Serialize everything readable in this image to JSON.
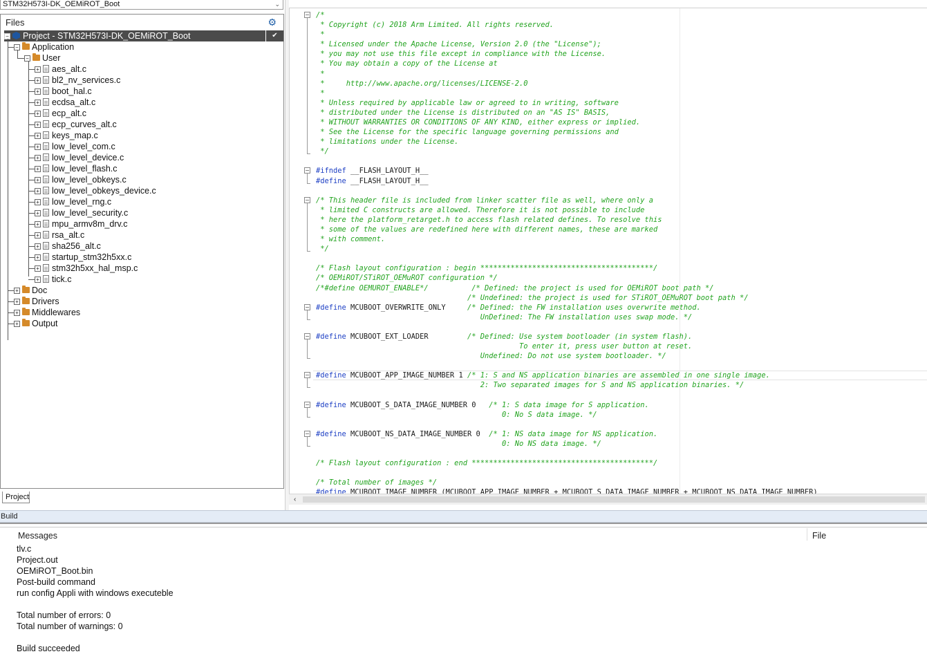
{
  "project_selector": "STM32H573I-DK_OEMiROT_Boot",
  "files_panel": {
    "title": "Files",
    "root": "Project - STM32H573I-DK_OEMiROT_Boot",
    "application": "Application",
    "user": "User",
    "user_files": [
      "aes_alt.c",
      "bl2_nv_services.c",
      "boot_hal.c",
      "ecdsa_alt.c",
      "ecp_alt.c",
      "ecp_curves_alt.c",
      "keys_map.c",
      "low_level_com.c",
      "low_level_device.c",
      "low_level_flash.c",
      "low_level_obkeys.c",
      "low_level_obkeys_device.c",
      "low_level_rng.c",
      "low_level_security.c",
      "mpu_armv8m_drv.c",
      "rsa_alt.c",
      "sha256_alt.c",
      "startup_stm32h5xx.c",
      "stm32h5xx_hal_msp.c",
      "tick.c"
    ],
    "folders": [
      "Doc",
      "Drivers",
      "Middlewares",
      "Output"
    ],
    "tab": "Project"
  },
  "editor": {
    "lines": [
      {
        "text": "/*",
        "kind": "cm"
      },
      {
        "text": " * Copyright (c) 2018 Arm Limited. All rights reserved.",
        "kind": "cm"
      },
      {
        "text": " *",
        "kind": "cm"
      },
      {
        "text": " * Licensed under the Apache License, Version 2.0 (the \"License\");",
        "kind": "cm"
      },
      {
        "text": " * you may not use this file except in compliance with the License.",
        "kind": "cm"
      },
      {
        "text": " * You may obtain a copy of the License at",
        "kind": "cm"
      },
      {
        "text": " *",
        "kind": "cm"
      },
      {
        "text": " *     http://www.apache.org/licenses/LICENSE-2.0",
        "kind": "cm"
      },
      {
        "text": " *",
        "kind": "cm"
      },
      {
        "text": " * Unless required by applicable law or agreed to in writing, software",
        "kind": "cm"
      },
      {
        "text": " * distributed under the License is distributed on an \"AS IS\" BASIS,",
        "kind": "cm"
      },
      {
        "text": " * WITHOUT WARRANTIES OR CONDITIONS OF ANY KIND, either express or implied.",
        "kind": "cm"
      },
      {
        "text": " * See the License for the specific language governing permissions and",
        "kind": "cm"
      },
      {
        "text": " * limitations under the License.",
        "kind": "cm"
      },
      {
        "text": " */",
        "kind": "cm"
      },
      {
        "text": "",
        "kind": "cm"
      },
      {
        "text": "#ifndef",
        "kind": "kw",
        "rest": " __FLASH_LAYOUT_H__"
      },
      {
        "text": "#define",
        "kind": "kw",
        "rest": " __FLASH_LAYOUT_H__"
      },
      {
        "text": "",
        "kind": "cm"
      },
      {
        "text": "/* This header file is included from linker scatter file as well, where only a",
        "kind": "cm"
      },
      {
        "text": " * limited C constructs are allowed. Therefore it is not possible to include",
        "kind": "cm"
      },
      {
        "text": " * here the platform_retarget.h to access flash related defines. To resolve this",
        "kind": "cm"
      },
      {
        "text": " * some of the values are redefined here with different names, these are marked",
        "kind": "cm"
      },
      {
        "text": " * with comment.",
        "kind": "cm"
      },
      {
        "text": " */",
        "kind": "cm"
      },
      {
        "text": "",
        "kind": "cm"
      },
      {
        "text": "/* Flash layout configuration : begin ****************************************/",
        "kind": "cm"
      },
      {
        "text": "/* OEMiROT/STiROT_OEMuROT configuration */",
        "kind": "cm"
      },
      {
        "text": "/*#define OEMUROT_ENABLE*/          /* Defined: the project is used for OEMiROT boot path */",
        "kind": "cm"
      },
      {
        "text": "                                   /* Undefined: the project is used for STiROT_OEMuROT boot path */",
        "kind": "cm"
      },
      {
        "text": "#define",
        "kind": "kw",
        "rest": " MCUBOOT_OVERWRITE_ONLY     ",
        "comment": "/* Defined: the FW installation uses overwrite method."
      },
      {
        "text": "                                      UnDefined: The FW installation uses swap mode. */",
        "kind": "cm"
      },
      {
        "text": "",
        "kind": "cm"
      },
      {
        "text": "#define",
        "kind": "kw",
        "rest": " MCUBOOT_EXT_LOADER         ",
        "comment": "/* Defined: Use system bootloader (in system flash)."
      },
      {
        "text": "                                               To enter it, press user button at reset.",
        "kind": "cm"
      },
      {
        "text": "                                      Undefined: Do not use system bootloader. */",
        "kind": "cm"
      },
      {
        "text": "",
        "kind": "cm"
      },
      {
        "text": "#define",
        "kind": "kw",
        "rest": " MCUBOOT_APP_IMAGE_NUMBER 1 ",
        "comment": "/* 1: S and NS application binaries are assembled in one single image."
      },
      {
        "text": "                                      2: Two separated images for S and NS application binaries. */",
        "kind": "cm"
      },
      {
        "text": "",
        "kind": "cm"
      },
      {
        "text": "#define",
        "kind": "kw",
        "rest": " MCUBOOT_S_DATA_IMAGE_NUMBER 0   ",
        "comment": "/* 1: S data image for S application."
      },
      {
        "text": "                                           0: No S data image. */",
        "kind": "cm"
      },
      {
        "text": "",
        "kind": "cm"
      },
      {
        "text": "#define",
        "kind": "kw",
        "rest": " MCUBOOT_NS_DATA_IMAGE_NUMBER 0  ",
        "comment": "/* 1: NS data image for NS application."
      },
      {
        "text": "                                           0: No NS data image. */",
        "kind": "cm"
      },
      {
        "text": "",
        "kind": "cm"
      },
      {
        "text": "/* Flash layout configuration : end ******************************************/",
        "kind": "cm"
      },
      {
        "text": "",
        "kind": "cm"
      },
      {
        "text": "/* Total number of images */",
        "kind": "cm"
      },
      {
        "text": "#define",
        "kind": "kw",
        "rest": " MCUBOOT_IMAGE_NUMBER (MCUBOOT_APP_IMAGE_NUMBER + MCUBOOT_S_DATA_IMAGE_NUMBER + MCUBOOT_NS_DATA_IMAGE_NUMBER)"
      }
    ]
  },
  "build": {
    "bar_label": "Build",
    "col_messages": "Messages",
    "col_file": "File",
    "messages": [
      "tlv.c",
      "Project.out",
      "OEMiROT_Boot.bin",
      "Post-build command",
      "run config Appli with windows executeble",
      "",
      "Total number of errors: 0",
      "Total number of warnings: 0",
      "",
      "Build succeeded"
    ]
  }
}
